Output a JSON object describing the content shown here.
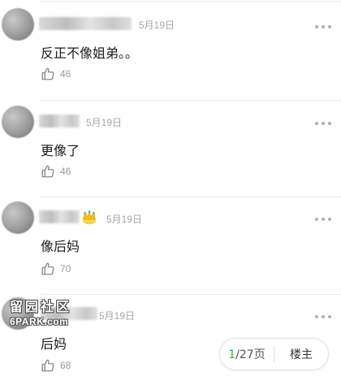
{
  "comments": [
    {
      "date": "5月19日",
      "text": "反正不像姐弟。。",
      "likes": "46"
    },
    {
      "date": "5月19日",
      "text": "更像了",
      "likes": "46"
    },
    {
      "date": "5月19日",
      "text": "像后妈",
      "likes": "70"
    },
    {
      "date": "5月19日",
      "text": "后妈",
      "likes": "68"
    }
  ],
  "watermark": {
    "top": "留园社区",
    "bottom": "6PARK.com"
  },
  "pager": {
    "current": "1",
    "total_suffix": "/27页",
    "op_label": "楼主"
  },
  "colors": {
    "accent": "#2bb24c",
    "meta": "#a6a6a6"
  },
  "icons": {
    "like": "thumbs-up-icon",
    "more": "more-dots-icon"
  }
}
